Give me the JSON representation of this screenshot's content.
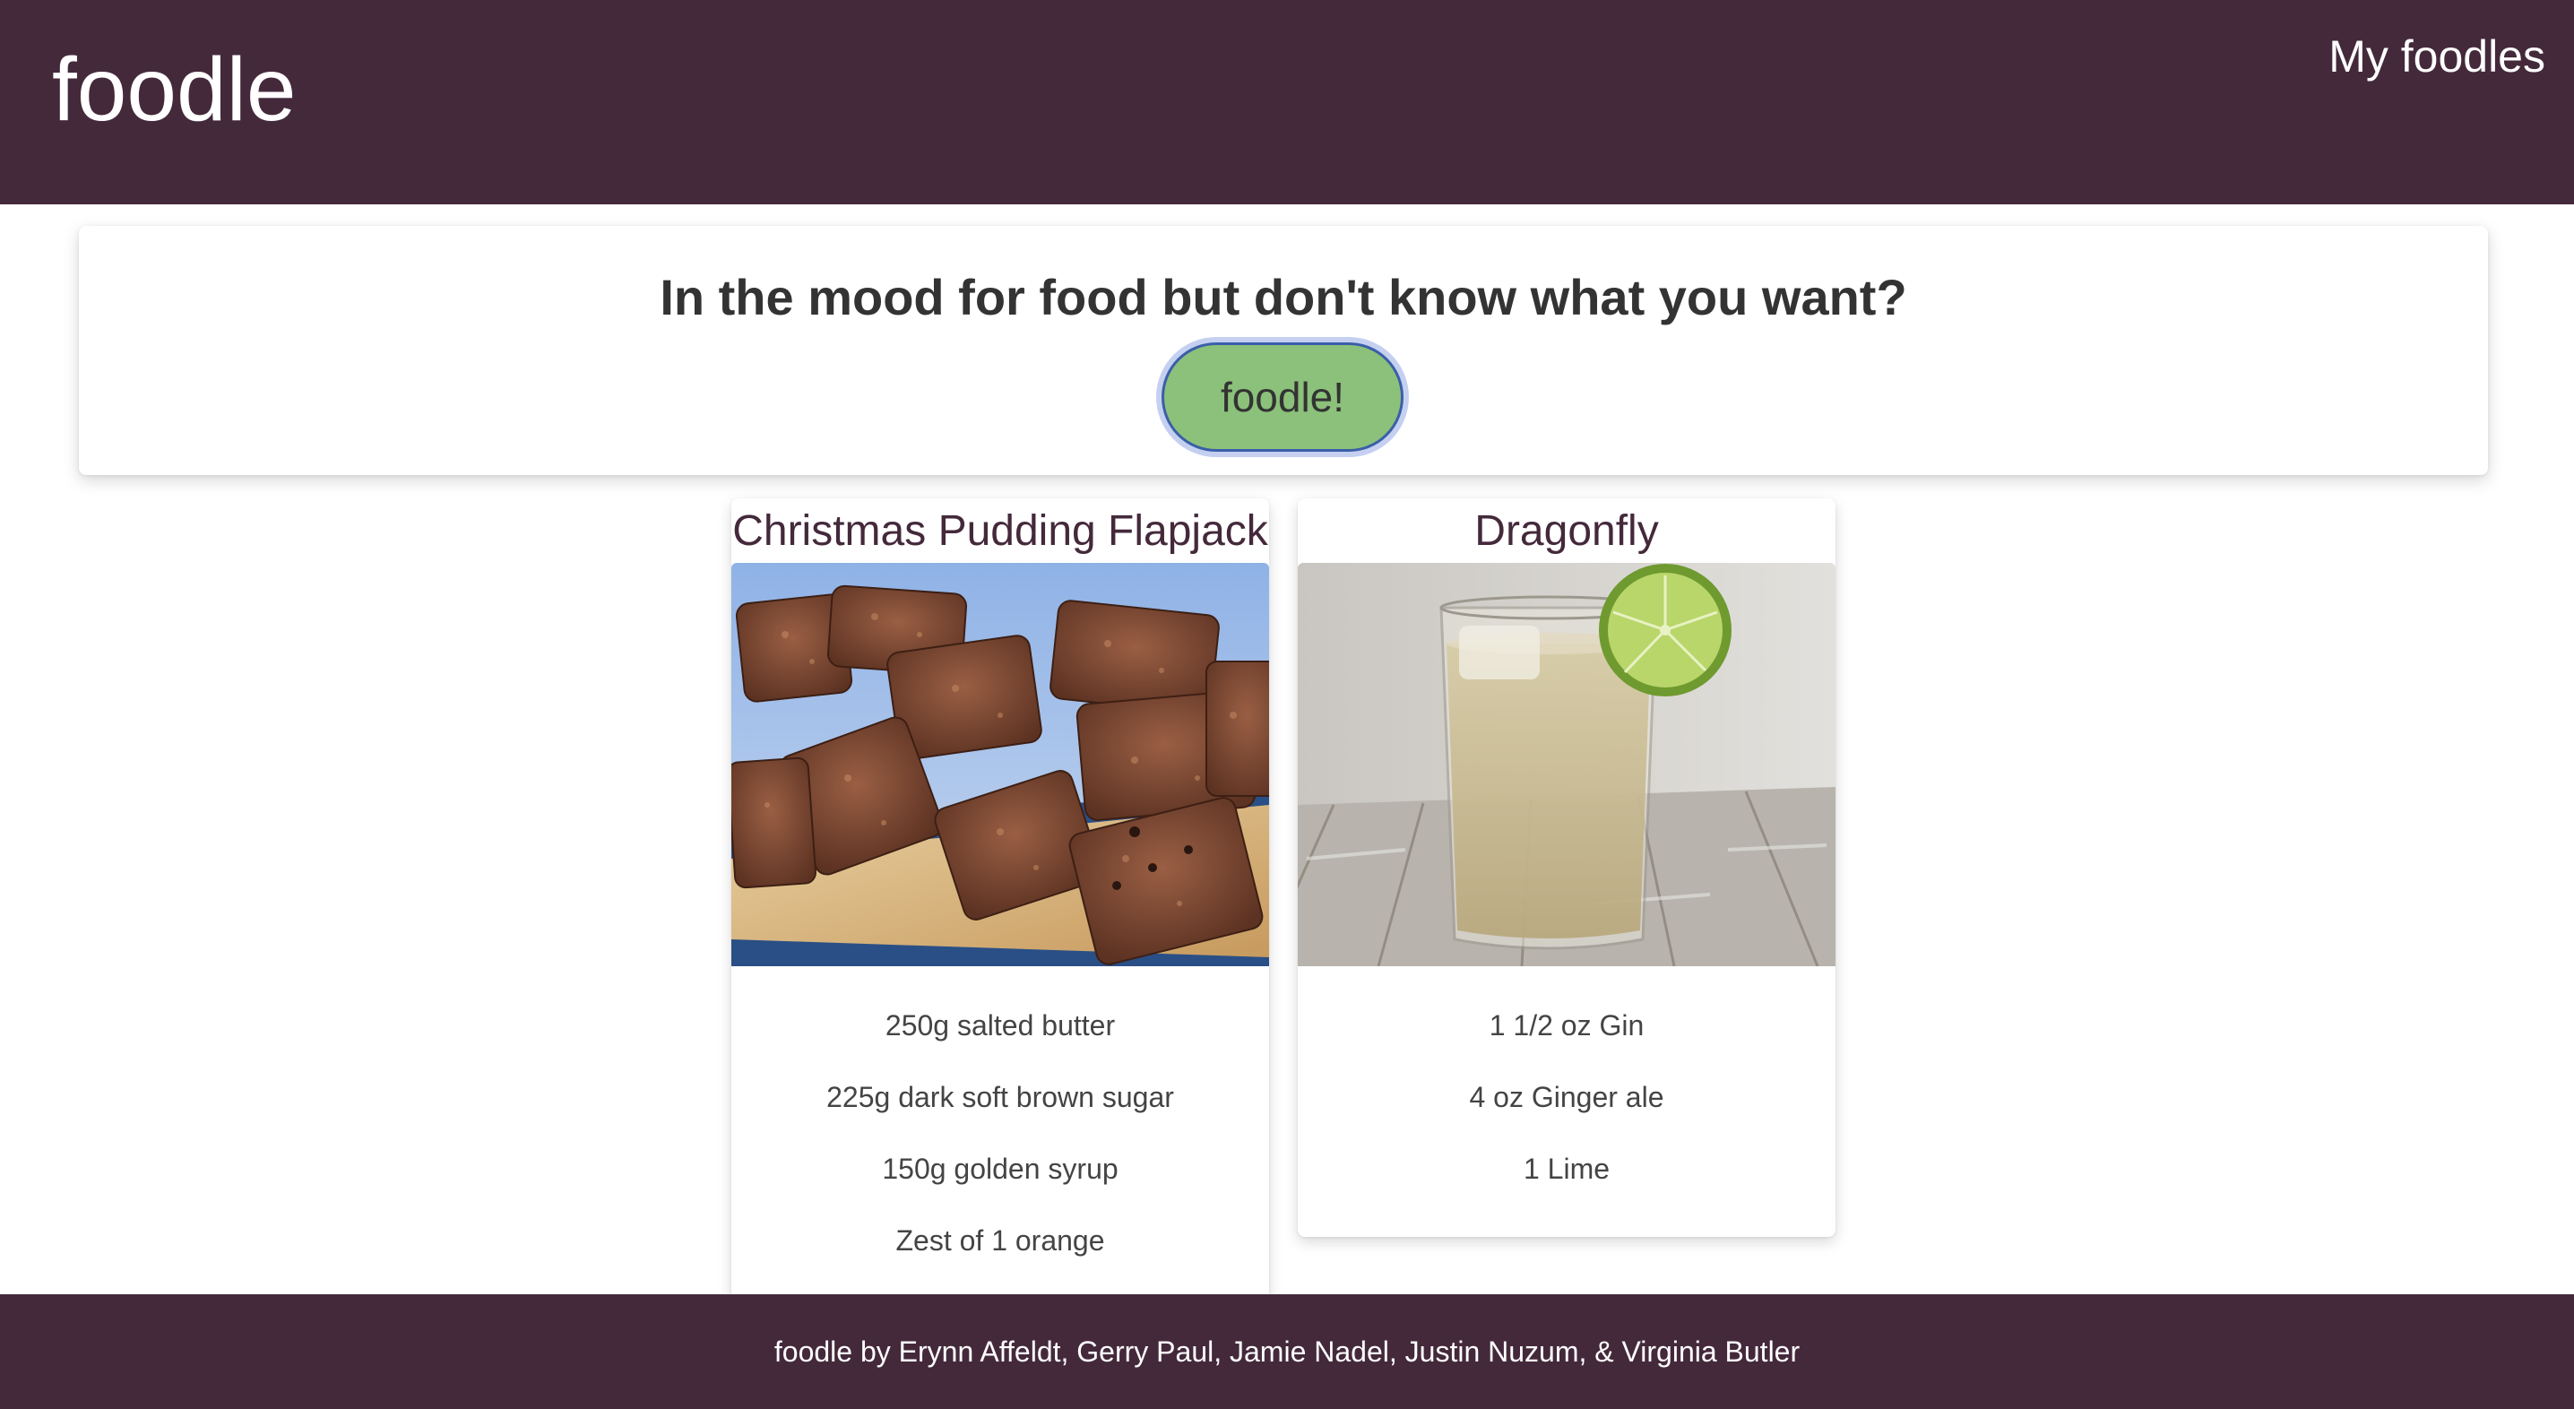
{
  "header": {
    "brand": "foodle",
    "nav_link": "My foodles"
  },
  "hero": {
    "title": "In the mood for food but don't know what you want?",
    "button_label": "foodle!"
  },
  "recipes": [
    {
      "title": "Christmas Pudding Flapjack",
      "image_subject": "flapjack-bars-photo",
      "ingredients": [
        "250g salted butter",
        "225g dark soft brown sugar",
        "150g golden syrup",
        "Zest of 1 orange"
      ]
    },
    {
      "title": "Dragonfly",
      "image_subject": "gin-ginger-ale-cocktail-photo",
      "ingredients": [
        "1 1/2 oz Gin",
        "4 oz Ginger ale",
        "1 Lime"
      ]
    }
  ],
  "footer": {
    "credits": "foodle by Erynn Affeldt, Gerry Paul, Jamie Nadel, Justin Nuzum, & Virginia Butler"
  },
  "colors": {
    "header_bg": "#44293b",
    "button_bg": "#8bc17a",
    "title_color": "#44293b"
  }
}
